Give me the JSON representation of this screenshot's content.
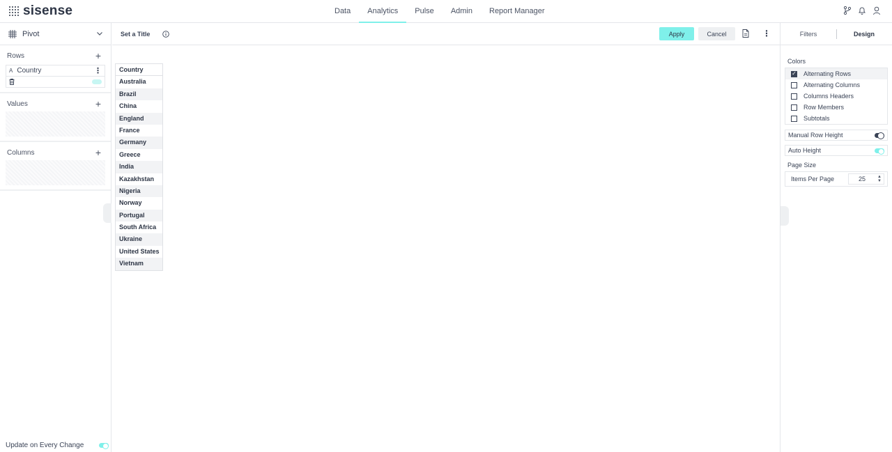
{
  "app": {
    "logo_text": "sisense"
  },
  "nav": {
    "items": [
      {
        "label": "Data",
        "active": false
      },
      {
        "label": "Analytics",
        "active": true
      },
      {
        "label": "Pulse",
        "active": false
      },
      {
        "label": "Admin",
        "active": false
      },
      {
        "label": "Report Manager",
        "active": false
      }
    ],
    "accent_color": "#7ff0ea"
  },
  "left_panel": {
    "widget_type": "Pivot",
    "rows": {
      "label": "Rows",
      "field": {
        "type_badge": "A",
        "name": "Country"
      }
    },
    "values": {
      "label": "Values"
    },
    "columns": {
      "label": "Columns"
    },
    "update_label": "Update on Every Change"
  },
  "toolbar": {
    "title_placeholder": "Set a Title",
    "apply_label": "Apply",
    "cancel_label": "Cancel"
  },
  "pivot": {
    "header": "Country",
    "rows": [
      "Australia",
      "Brazil",
      "China",
      "England",
      "France",
      "Germany",
      "Greece",
      "India",
      "Kazakhstan",
      "Nigeria",
      "Norway",
      "Portugal",
      "South Africa",
      "Ukraine",
      "United States",
      "Vietnam"
    ]
  },
  "right_panel": {
    "tabs": [
      {
        "label": "Filters",
        "active": false
      },
      {
        "label": "Design",
        "active": true
      }
    ],
    "colors_label": "Colors",
    "color_options": [
      {
        "label": "Alternating Rows",
        "checked": true
      },
      {
        "label": "Alternating Columns",
        "checked": false
      },
      {
        "label": "Columns Headers",
        "checked": false
      },
      {
        "label": "Row Members",
        "checked": false
      },
      {
        "label": "Subtotals",
        "checked": false
      }
    ],
    "manual_row_height_label": "Manual Row Height",
    "auto_height_label": "Auto Height",
    "page_size_label": "Page Size",
    "items_per_page_label": "Items Per Page",
    "items_per_page_value": "25"
  }
}
